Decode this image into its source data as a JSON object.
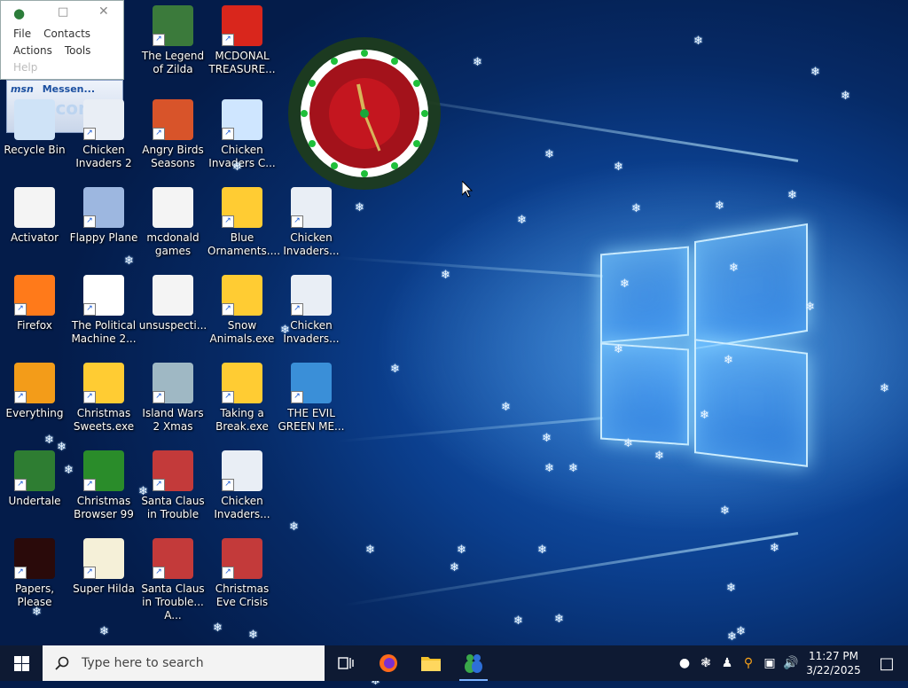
{
  "mini_window": {
    "menu_row1": [
      "File",
      "Contacts"
    ],
    "menu_row2": [
      "Actions",
      "Tools"
    ],
    "menu_row3": [
      "Help"
    ]
  },
  "msn_gadget": {
    "brand": "msn",
    "title": "Messen...",
    "welcome": "welcome"
  },
  "desktop_icons": [
    {
      "label": "Recycle Bin",
      "icon": "recycle-bin-icon"
    },
    {
      "label": "Activator",
      "icon": "file-icon"
    },
    {
      "label": "Firefox",
      "icon": "firefox-icon"
    },
    {
      "label": "Everything",
      "icon": "everything-search-icon"
    },
    {
      "label": "Undertale",
      "icon": "undertale-icon"
    },
    {
      "label": "Papers, Please",
      "icon": "papers-please-icon"
    },
    {
      "label": "Chicken Invaders 2",
      "icon": "chicken-invaders-icon"
    },
    {
      "label": "Flappy Plane",
      "icon": "game-icon"
    },
    {
      "label": "The Political Machine 2...",
      "icon": "political-machine-icon"
    },
    {
      "label": "Christmas Sweets.exe",
      "icon": "ornament-game-icon"
    },
    {
      "label": "Christmas Browser 99",
      "icon": "christmas-tree-icon"
    },
    {
      "label": "Super Hilda",
      "icon": "super-hilda-icon"
    },
    {
      "label": "The Legend of Zilda",
      "icon": "zilda-icon"
    },
    {
      "label": "Angry Birds Seasons",
      "icon": "angry-birds-icon"
    },
    {
      "label": "mcdonald games",
      "icon": "file-icon"
    },
    {
      "label": "unsuspecti...",
      "icon": "file-icon"
    },
    {
      "label": "Island Wars 2 Xmas",
      "icon": "island-wars-icon"
    },
    {
      "label": "Santa Claus in Trouble",
      "icon": "santa-icon"
    },
    {
      "label": "Santa Claus in Trouble... A...",
      "icon": "santa-icon"
    },
    {
      "label": "MCDONAL TREASURE...",
      "icon": "mcdonalds-icon"
    },
    {
      "label": "Chicken Invaders C...",
      "icon": "snowman-icon"
    },
    {
      "label": "Blue Ornaments....",
      "icon": "ornament-game-icon"
    },
    {
      "label": "Snow Animals.exe",
      "icon": "ornament-game-icon"
    },
    {
      "label": "Taking a Break.exe",
      "icon": "ornament-game-icon"
    },
    {
      "label": "Chicken Invaders...",
      "icon": "chicken-invaders-icon"
    },
    {
      "label": "Christmas Eve Crisis",
      "icon": "santa-icon"
    },
    {
      "label": "Chicken Invaders...",
      "icon": "chicken-invaders-icon"
    },
    {
      "label": "Chicken Invaders...",
      "icon": "chicken-invaders-icon"
    },
    {
      "label": "THE EVIL GREEN ME...",
      "icon": "msn-messenger-icon"
    }
  ],
  "taskbar": {
    "search_placeholder": "Type here to search",
    "time": "11:27 PM",
    "date": "3/22/2025"
  },
  "colors": {
    "taskbar": "#0e1a33",
    "desktop": "#0b3f8e"
  }
}
